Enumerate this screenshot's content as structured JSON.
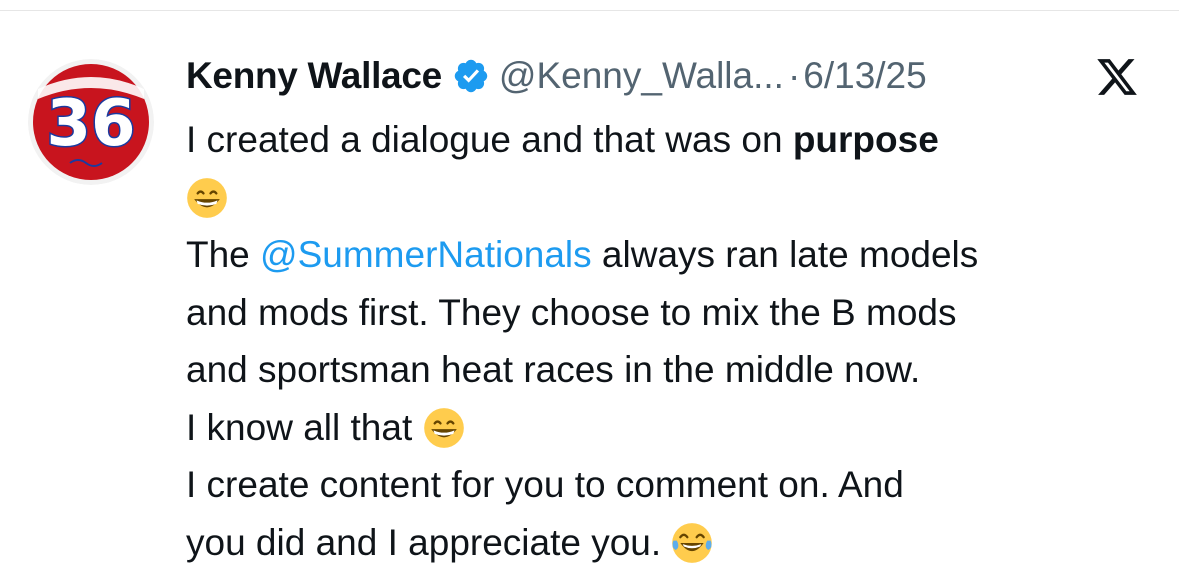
{
  "tweet": {
    "author": {
      "display_name": "Kenny Wallace",
      "handle": "@Kenny_Walla...",
      "avatar_text": "36",
      "verified": true
    },
    "separator": "·",
    "date": "6/13/25",
    "body": {
      "line1_pre": "I created a dialogue and that was on ",
      "line1_bold": "purpose",
      "line3_pre": "The ",
      "mention": "@SummerNationals",
      "line3_post": " always ran late models",
      "line4": "and mods first. They choose to mix the B mods",
      "line5": "and sportsman heat races in the middle now.",
      "line6": "I know all that ",
      "line7": "I create content for you to comment on. And",
      "line8": "you did and I appreciate you. "
    },
    "emojis": [
      "grinning-face",
      "grinning-face",
      "tears-of-joy-face"
    ]
  },
  "colors": {
    "text": "#0f1419",
    "secondary": "#536471",
    "link": "#1d9bf0",
    "verified": "#1d9bf0",
    "avatar_red": "#c8141e"
  }
}
